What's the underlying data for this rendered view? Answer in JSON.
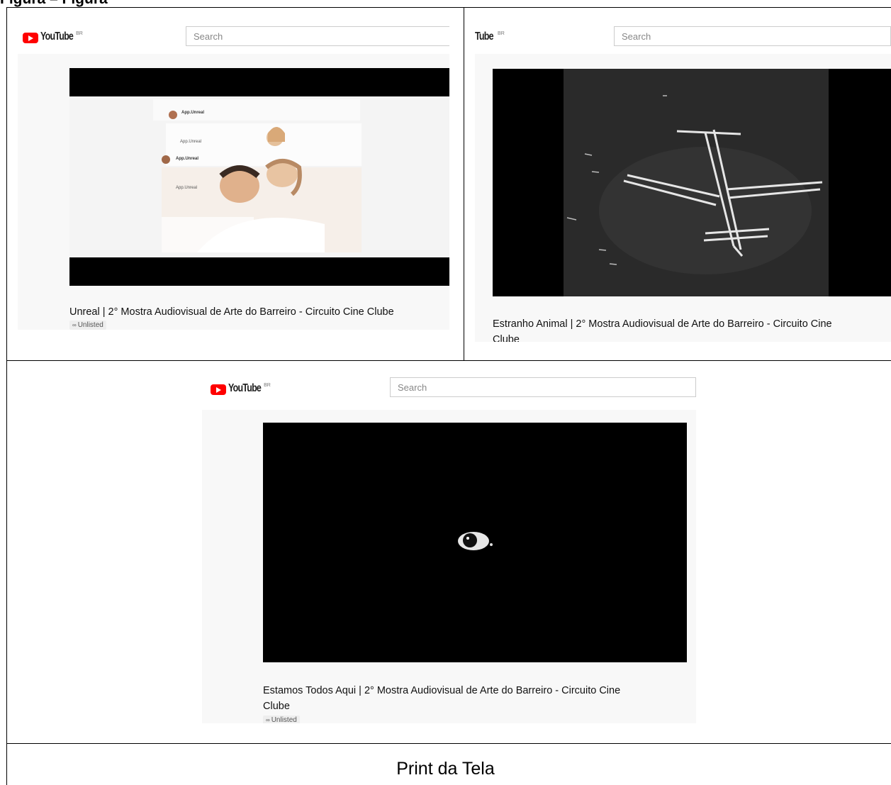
{
  "figure_heading": "Figura – Figura",
  "youtube": {
    "logo_text": "YouTube",
    "region": "BR",
    "cropped_logo_text": "Tube",
    "search_placeholder": "Search",
    "unlisted_label": "Unlisted"
  },
  "screens": [
    {
      "video_title": "Unreal | 2° Mostra Audiovisual de Arte do Barreiro - Circuito Cine Clube",
      "app_labels": [
        "App.Unreal",
        "App.Unreal",
        "App.Unreal",
        "App.Unreal"
      ]
    },
    {
      "video_title_line1": "Estranho Animal | 2° Mostra Audiovisual de Arte do Barreiro - Circuito Cine",
      "video_title_line2": "Clube"
    },
    {
      "video_title_line1": "Estamos Todos Aqui | 2° Mostra Audiovisual de Arte do Barreiro - Circuito Cine",
      "video_title_line2": "Clube"
    }
  ],
  "caption": "Print da Tela"
}
